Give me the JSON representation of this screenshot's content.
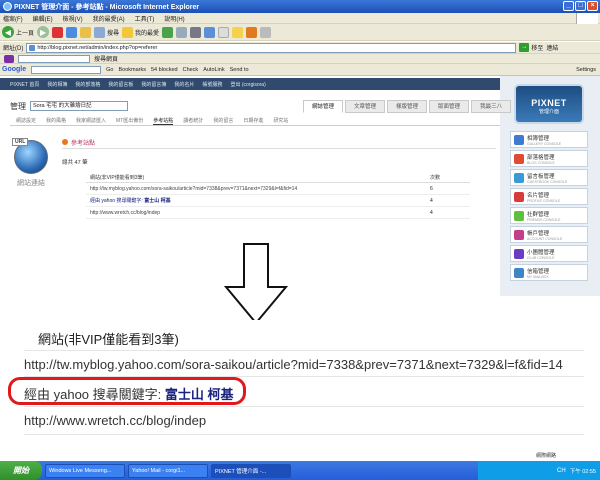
{
  "window": {
    "title": "PIXNET 管理介面 - 參考站點 - Microsoft Internet Explorer"
  },
  "menubar": [
    "檔案(F)",
    "編輯(E)",
    "檢視(V)",
    "我的最愛(A)",
    "工具(T)",
    "說明(H)"
  ],
  "toolbar": {
    "back_label": "上一頁",
    "search_label": "搜尋",
    "favorites_label": "我的最愛"
  },
  "address": {
    "label": "網址(D)",
    "url": "http://blog.pixnet.net/admin/index.php?op=referer",
    "go_label": "移至",
    "links_label": "連結"
  },
  "linkbar": {
    "search_button": "搜尋網頁"
  },
  "googlebar": {
    "logo": "Google",
    "go_label": "Go",
    "bookmarks": "Bookmarks",
    "blocked": "54 blocked",
    "check": "Check",
    "autolink": "AutoLink",
    "send_to": "Send to",
    "settings": "Settings"
  },
  "pixnet": {
    "top_nav": [
      "PIXNET 首頁",
      "我的相簿",
      "我的部落格",
      "我的留言板",
      "我的留言簿",
      "我的名片",
      "帳號服務",
      "登出 (corgisora)"
    ],
    "logo_main": "PIXNET",
    "logo_sub": "管理介面",
    "manage_label": "管理",
    "blog_select": "Sora 宅宅 的大雜燴日記",
    "main_tabs": [
      "網誌管理",
      "文章管理",
      "樣版管理",
      "版面管理",
      "我最三八"
    ],
    "active_main_tab": "網誌管理",
    "sub_tabs": [
      "網誌設定",
      "我的風格",
      "我家網誌匯入",
      "MT匯出備份",
      "參考站點",
      "讀者統計",
      "我的留言",
      "日期存進",
      "研究站"
    ],
    "active_sub_tab": "參考站點",
    "consoles": [
      {
        "name": "相簿管理",
        "sub": "GALLERY CONSOLE",
        "color": "#3d7bd0"
      },
      {
        "name": "部落格管理",
        "sub": "BLOG CONSOLE",
        "color": "#e04b33"
      },
      {
        "name": "留言板管理",
        "sub": "GUESTBOOK CONSOLE",
        "color": "#3a9ad8"
      },
      {
        "name": "名片管理",
        "sub": "PROFILE CONSOLE",
        "color": "#d93b3b"
      },
      {
        "name": "社群管理",
        "sub": "FRIENDS CONSOLE",
        "color": "#5cbf3d"
      },
      {
        "name": "帳戶管理",
        "sub": "ACCOUNT CONSOLE",
        "color": "#c53c8a"
      },
      {
        "name": "小團體管理",
        "sub": "CLUB CONSOLE",
        "color": "#6a3cc5"
      },
      {
        "name": "信箱管理",
        "sub": "MY MAILBOX",
        "color": "#3c86c5"
      }
    ]
  },
  "referer": {
    "sidebar_badge": "URL",
    "sidebar_label": "網站連結",
    "panel_title": "參考站點",
    "total": "總共 47 筆",
    "col_site": "網站(非VIP僅能看到3筆)",
    "col_count": "次數",
    "rows": [
      {
        "site": "http://tw.myblog.yahoo.com/sora-saikou/article?mid=7338&prev=7371&next=7329&l=f&fid=14",
        "count": "6",
        "type": "url"
      },
      {
        "site_prefix": "經由 yahoo 搜尋關鍵字:",
        "keyword": "富士山 柯基",
        "count": "4",
        "type": "keyword"
      },
      {
        "site": "http://www.wretch.cc/blog/indep",
        "count": "4",
        "type": "url"
      }
    ]
  },
  "zoom": {
    "title": "網站(非VIP僅能看到3筆)",
    "row1": "http://tw.myblog.yahoo.com/sora-saikou/article?mid=7338&prev=7371&next=7329&l=f&fid=14",
    "row2_prefix": "經由 yahoo 搜尋關鍵字:",
    "row2_keyword": "富士山 柯基",
    "row3": "http://www.wretch.cc/blog/indep"
  },
  "status": {
    "zone": "網際網路"
  },
  "taskbar": {
    "start": "開始",
    "tasks": [
      "Windows Live Messeng...",
      "Yahoo! Mail - corgi1...",
      "PIXNET 管理介面 -..."
    ],
    "active_task": 2,
    "lang": "CH",
    "clock": "下午 02:55"
  }
}
